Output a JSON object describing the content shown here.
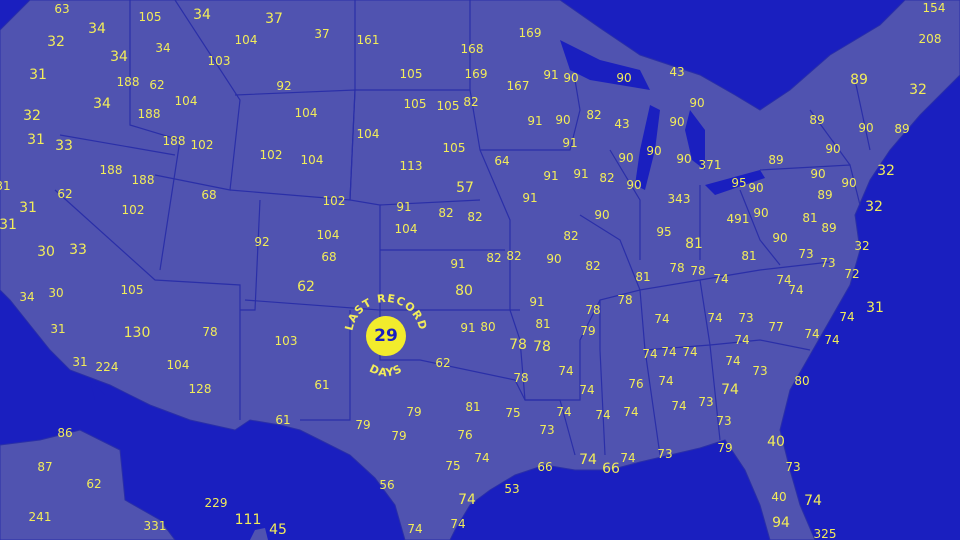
{
  "colors": {
    "ocean": "#1a1fbf",
    "land": "#5053b0",
    "border": "#2a2fa8",
    "label": "#f2ec5a",
    "badge": "#f2ec2c"
  },
  "badge": {
    "value": "29",
    "top_text": "LAST RECORD",
    "bottom_text": "DAYS"
  },
  "labels": [
    {
      "t": "63"
    },
    {
      "t": "105"
    },
    {
      "t": "34"
    },
    {
      "t": "37"
    },
    {
      "t": "154"
    },
    {
      "t": "34"
    },
    {
      "t": "32"
    },
    {
      "t": "104"
    },
    {
      "t": "37"
    },
    {
      "t": "161"
    },
    {
      "t": "168"
    },
    {
      "t": "169"
    },
    {
      "t": "208"
    },
    {
      "t": "34"
    },
    {
      "t": "34"
    },
    {
      "t": "103"
    },
    {
      "t": "31"
    },
    {
      "t": "188"
    },
    {
      "t": "62"
    },
    {
      "t": "92"
    },
    {
      "t": "105"
    },
    {
      "t": "169"
    },
    {
      "t": "167"
    },
    {
      "t": "91"
    },
    {
      "t": "90"
    },
    {
      "t": "90"
    },
    {
      "t": "43"
    },
    {
      "t": "89"
    },
    {
      "t": "34"
    },
    {
      "t": "104"
    },
    {
      "t": "32"
    },
    {
      "t": "32"
    },
    {
      "t": "188"
    },
    {
      "t": "104"
    },
    {
      "t": "105"
    },
    {
      "t": "105"
    },
    {
      "t": "82"
    },
    {
      "t": "90"
    },
    {
      "t": "91"
    },
    {
      "t": "90"
    },
    {
      "t": "82"
    },
    {
      "t": "43"
    },
    {
      "t": "90"
    },
    {
      "t": "89"
    },
    {
      "t": "90"
    },
    {
      "t": "89"
    },
    {
      "t": "31"
    },
    {
      "t": "33"
    },
    {
      "t": "188"
    },
    {
      "t": "102"
    },
    {
      "t": "104"
    },
    {
      "t": "105"
    },
    {
      "t": "91"
    },
    {
      "t": "102"
    },
    {
      "t": "104"
    },
    {
      "t": "64"
    },
    {
      "t": "90"
    },
    {
      "t": "90"
    },
    {
      "t": "90"
    },
    {
      "t": "371"
    },
    {
      "t": "89"
    },
    {
      "t": "90"
    },
    {
      "t": "113"
    },
    {
      "t": "188"
    },
    {
      "t": "188"
    },
    {
      "t": "91"
    },
    {
      "t": "91"
    },
    {
      "t": "82"
    },
    {
      "t": "90"
    },
    {
      "t": "95"
    },
    {
      "t": "90"
    },
    {
      "t": "90"
    },
    {
      "t": "32"
    },
    {
      "t": "31"
    },
    {
      "t": "57"
    },
    {
      "t": "90"
    },
    {
      "t": "62"
    },
    {
      "t": "68"
    },
    {
      "t": "91"
    },
    {
      "t": "343"
    },
    {
      "t": "89"
    },
    {
      "t": "31"
    },
    {
      "t": "102"
    },
    {
      "t": "102"
    },
    {
      "t": "91"
    },
    {
      "t": "82"
    },
    {
      "t": "82"
    },
    {
      "t": "90"
    },
    {
      "t": "491"
    },
    {
      "t": "90"
    },
    {
      "t": "32"
    },
    {
      "t": "31"
    },
    {
      "t": "104"
    },
    {
      "t": "95"
    },
    {
      "t": "81"
    },
    {
      "t": "89"
    },
    {
      "t": "104"
    },
    {
      "t": "82"
    },
    {
      "t": "30"
    },
    {
      "t": "33"
    },
    {
      "t": "92"
    },
    {
      "t": "81"
    },
    {
      "t": "90"
    },
    {
      "t": "32"
    },
    {
      "t": "68"
    },
    {
      "t": "82"
    },
    {
      "t": "82"
    },
    {
      "t": "90"
    },
    {
      "t": "81"
    },
    {
      "t": "73"
    },
    {
      "t": "91"
    },
    {
      "t": "82"
    },
    {
      "t": "78"
    },
    {
      "t": "78"
    },
    {
      "t": "74"
    },
    {
      "t": "74"
    },
    {
      "t": "81"
    },
    {
      "t": "73"
    },
    {
      "t": "62"
    },
    {
      "t": "80"
    },
    {
      "t": "34"
    },
    {
      "t": "30"
    },
    {
      "t": "105"
    },
    {
      "t": "91"
    },
    {
      "t": "78"
    },
    {
      "t": "74"
    },
    {
      "t": "78"
    },
    {
      "t": "72"
    },
    {
      "t": "74"
    },
    {
      "t": "74"
    },
    {
      "t": "73"
    },
    {
      "t": "31"
    },
    {
      "t": "31"
    },
    {
      "t": "130"
    },
    {
      "t": "78"
    },
    {
      "t": "91"
    },
    {
      "t": "80"
    },
    {
      "t": "81"
    },
    {
      "t": "79"
    },
    {
      "t": "74"
    },
    {
      "t": "77"
    },
    {
      "t": "74"
    },
    {
      "t": "103"
    },
    {
      "t": "74"
    },
    {
      "t": "74"
    },
    {
      "t": "78"
    },
    {
      "t": "78"
    },
    {
      "t": "31"
    },
    {
      "t": "224"
    },
    {
      "t": "104"
    },
    {
      "t": "62"
    },
    {
      "t": "74"
    },
    {
      "t": "74"
    },
    {
      "t": "74"
    },
    {
      "t": "80"
    },
    {
      "t": "74"
    },
    {
      "t": "128"
    },
    {
      "t": "61"
    },
    {
      "t": "78"
    },
    {
      "t": "74"
    },
    {
      "t": "76"
    },
    {
      "t": "74"
    },
    {
      "t": "74"
    },
    {
      "t": "73"
    },
    {
      "t": "61"
    },
    {
      "t": "79"
    },
    {
      "t": "79"
    },
    {
      "t": "81"
    },
    {
      "t": "75"
    },
    {
      "t": "74"
    },
    {
      "t": "74"
    },
    {
      "t": "74"
    },
    {
      "t": "74"
    },
    {
      "t": "73"
    },
    {
      "t": "86"
    },
    {
      "t": "79"
    },
    {
      "t": "76"
    },
    {
      "t": "73"
    },
    {
      "t": "74"
    },
    {
      "t": "73"
    },
    {
      "t": "40"
    },
    {
      "t": "87"
    },
    {
      "t": "75"
    },
    {
      "t": "74"
    },
    {
      "t": "66"
    },
    {
      "t": "74"
    },
    {
      "t": "66"
    },
    {
      "t": "74"
    },
    {
      "t": "73"
    },
    {
      "t": "79"
    },
    {
      "t": "62"
    },
    {
      "t": "56"
    },
    {
      "t": "73"
    },
    {
      "t": "229"
    },
    {
      "t": "53"
    },
    {
      "t": "241"
    },
    {
      "t": "111"
    },
    {
      "t": "74"
    },
    {
      "t": "40"
    },
    {
      "t": "74"
    },
    {
      "t": "331"
    },
    {
      "t": "45"
    },
    {
      "t": "74"
    },
    {
      "t": "74"
    },
    {
      "t": "94"
    },
    {
      "t": "325"
    }
  ]
}
